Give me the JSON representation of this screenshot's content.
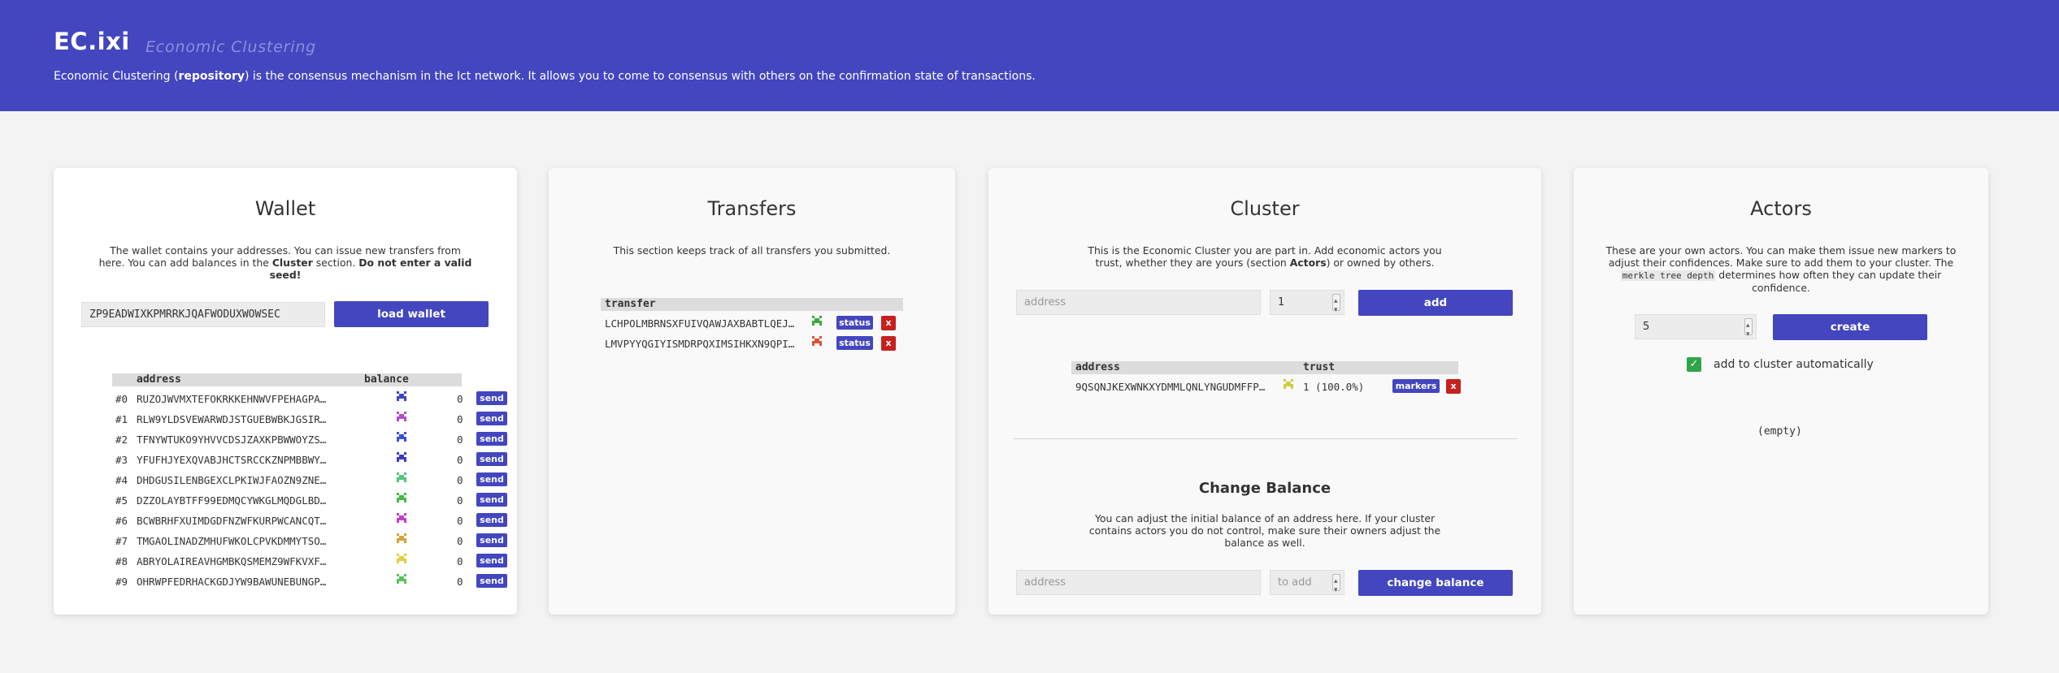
{
  "header": {
    "logo": "EC.ixi",
    "tagline": "Economic Clustering",
    "intro_pre": "Economic Clustering (",
    "intro_link": "repository",
    "intro_post": ") is the consensus mechanism in the Ict network. It allows you to come to consensus with others on the confirmation state of transactions."
  },
  "colors": {
    "header_bg": "#4346bf",
    "button": "#4346bf",
    "delete": "#c6201f",
    "checkbox": "#2fa54a"
  },
  "wallet": {
    "title": "Wallet",
    "desc_1": "The wallet contains your addresses. You can issue new transfers from",
    "desc_2a": "here. You can add balances in the ",
    "desc_2b": "Cluster",
    "desc_2c": " section. ",
    "desc_2d": "Do not enter a valid",
    "desc_3": "seed!",
    "seed_value": "ZP9EADWIXKPMRRKJQAFWODUXWOWSEC",
    "load_button": "load wallet",
    "col_address": "address",
    "col_balance": "balance",
    "send_label": "send",
    "rows": [
      {
        "idx": "#0",
        "address": "RUZOJWVMXTEFOKRKKEHNWVFPEHAGPA…",
        "balance": "0",
        "icon_color": "#3b45c9"
      },
      {
        "idx": "#1",
        "address": "RLW9YLDSVEWARWDJSTGUEBWBKJGSIR…",
        "balance": "0",
        "icon_color": "#b44ac9"
      },
      {
        "idx": "#2",
        "address": "TFNYWTUKO9YHVVCDSJZAXKPBWWOYZS…",
        "balance": "0",
        "icon_color": "#3c4fd6"
      },
      {
        "idx": "#3",
        "address": "YFUFHJYEXQVABJHCTSRCCKZNPMBBWY…",
        "balance": "0",
        "icon_color": "#3c3cc0"
      },
      {
        "idx": "#4",
        "address": "DHDGUSILENBGEXCLPKIWJFAOZN9ZNE…",
        "balance": "0",
        "icon_color": "#52c479"
      },
      {
        "idx": "#5",
        "address": "DZZOLAYBTFF99EDMQCYWKGLMQDGLBD…",
        "balance": "0",
        "icon_color": "#48b84a"
      },
      {
        "idx": "#6",
        "address": "BCWBRHFXUIMDGDFNZWFKURPWCANCQT…",
        "balance": "0",
        "icon_color": "#c43fc9"
      },
      {
        "idx": "#7",
        "address": "TMGAOLINADZMHUFWKOLCPVKDMMYTSO…",
        "balance": "0",
        "icon_color": "#d6a23a"
      },
      {
        "idx": "#8",
        "address": "ABRYOLAIREAVHGMBKQSMEMZ9WFKVXF…",
        "balance": "0",
        "icon_color": "#e0d040"
      },
      {
        "idx": "#9",
        "address": "OHRWPFEDRHACKGDJYW9BAWUNEBUNGP…",
        "balance": "0",
        "icon_color": "#5cc05c"
      }
    ]
  },
  "transfers": {
    "title": "Transfers",
    "desc": "This section keeps track of all transfers you submitted.",
    "col_transfer": "transfer",
    "status_label": "status",
    "delete_label": "x",
    "rows": [
      {
        "hash": "LCHPOLMBRNSXFUIVQAWJAXBABTLQEJ…",
        "icon_color": "#3fa83f"
      },
      {
        "hash": "LMVPYYQGIYISMDRPQXIMSIHKXN9QPI…",
        "icon_color": "#d6553a"
      }
    ]
  },
  "cluster": {
    "title": "Cluster",
    "desc_1": "This is the Economic Cluster you are part in. Add economic actors you",
    "desc_2a": "trust, whether they are yours (section ",
    "desc_2b": "Actors",
    "desc_2c": ") or owned by others.",
    "address_placeholder": "address",
    "trust_value": "1",
    "add_button": "add",
    "col_address": "address",
    "col_trust": "trust",
    "markers_label": "markers",
    "delete_label": "x",
    "rows": [
      {
        "address": "9QSQNJKEXWNKXYDMMLQNLYNGUDMFFP…",
        "trust": "1 (100.0%)",
        "icon_color": "#c8d040"
      }
    ],
    "change_balance": {
      "title": "Change Balance",
      "desc_1": "You can adjust the initial balance of an address here. If your cluster",
      "desc_2": "contains actors you do not control, make sure their owners adjust the",
      "desc_3": "balance as well.",
      "address_placeholder": "address",
      "amount_placeholder": "to add",
      "button": "change balance"
    }
  },
  "actors": {
    "title": "Actors",
    "desc_1": "These are your own actors. You can make them issue new markers to",
    "desc_2": "adjust their confidences. Make sure to add them to your cluster. The",
    "desc_3a": "merkle tree depth",
    "desc_3b": " determines how often they can update their",
    "desc_4": "confidence.",
    "depth_value": "5",
    "create_button": "create",
    "auto_add_checked": true,
    "auto_add_label": "add to cluster automatically",
    "empty_text": "(empty)"
  }
}
